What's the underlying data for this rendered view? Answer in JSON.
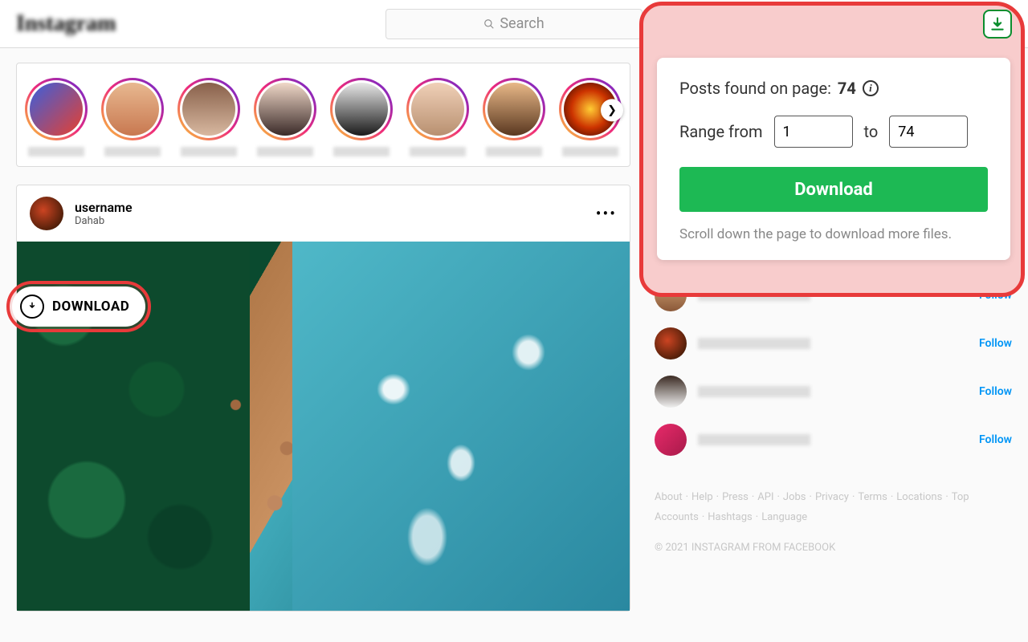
{
  "header": {
    "logo": "Instagram",
    "search_placeholder": "Search"
  },
  "post": {
    "username": "username",
    "location": "Dahab",
    "download_label": "DOWNLOAD"
  },
  "extension": {
    "title_prefix": "Posts found on page: ",
    "count": "74",
    "range_from_label": "Range from",
    "range_to_label": "to",
    "range_from": "1",
    "range_to": "74",
    "download_label": "Download",
    "note": "Scroll down the page to download more files."
  },
  "suggestions": {
    "follow_label": "Follow"
  },
  "footer": {
    "links": [
      "About",
      "Help",
      "Press",
      "API",
      "Jobs",
      "Privacy",
      "Terms",
      "Locations",
      "Top Accounts",
      "Hashtags",
      "Language"
    ],
    "copyright": "© 2021 INSTAGRAM FROM FACEBOOK"
  }
}
